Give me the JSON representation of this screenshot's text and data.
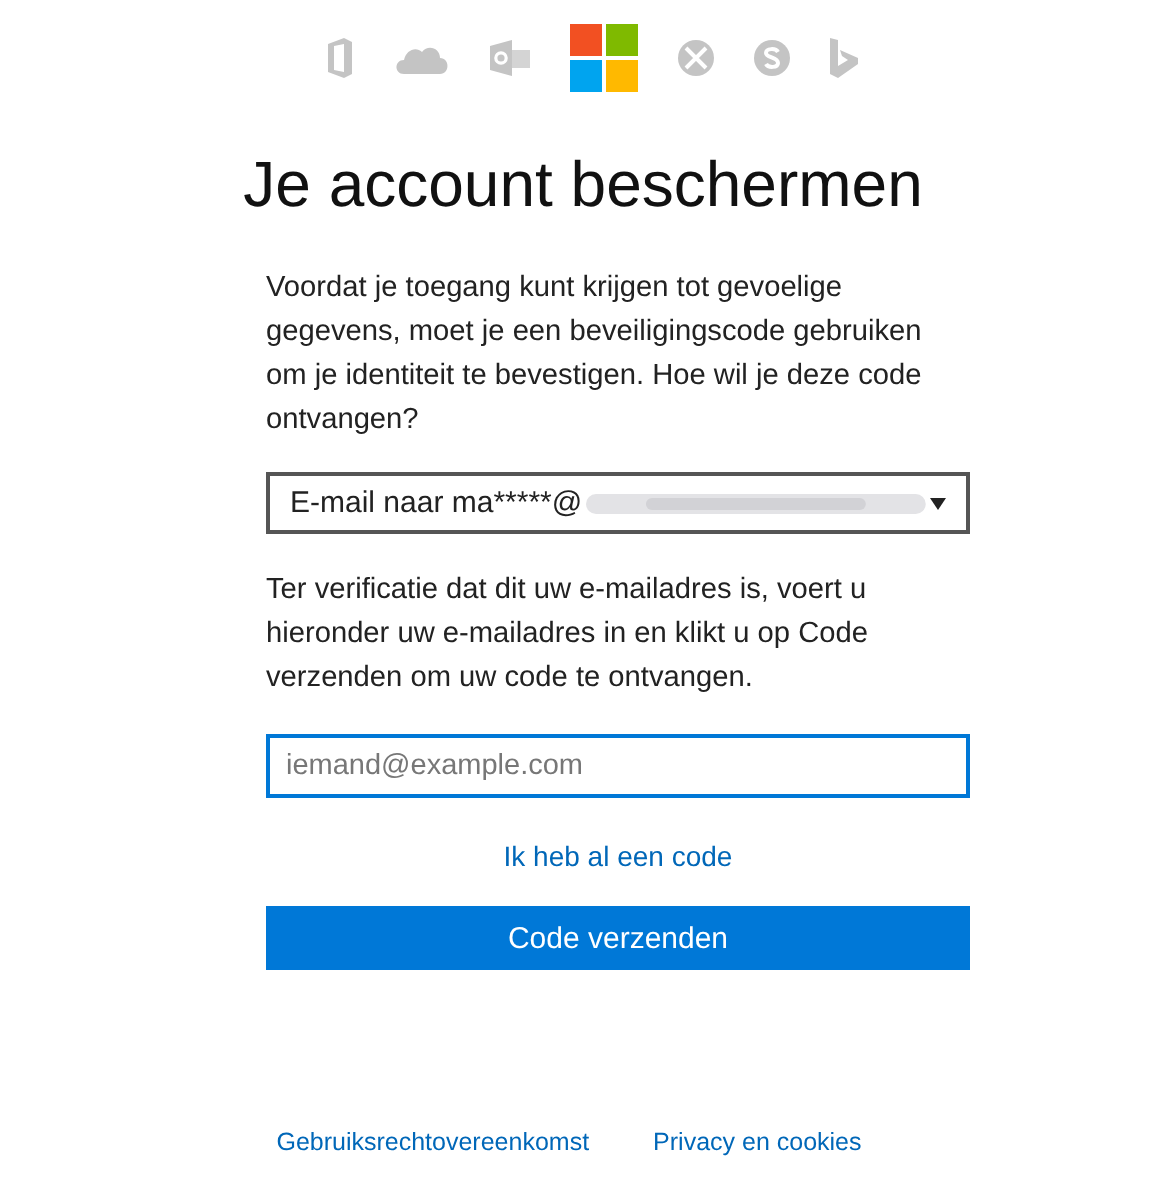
{
  "title": "Je account beschermen",
  "intro": "Voordat je toegang kunt krijgen tot gevoelige gegevens, moet je een beveiligingscode gebruiken om je identiteit te bevestigen. Hoe wil je deze code ontvangen?",
  "method_select": {
    "value": "E-mail naar ma*****@"
  },
  "instructions": "Ter verificatie dat dit uw e-mailadres is, voert u hieronder uw e-mailadres in en klikt u op Code verzenden om uw code te ontvangen.",
  "email_field": {
    "placeholder": "iemand@example.com"
  },
  "have_code_link": "Ik heb al een code",
  "send_button": "Code verzenden",
  "footer_links": [
    "Gebruiksrechtovereenkomst",
    "Privacy en cookies"
  ]
}
